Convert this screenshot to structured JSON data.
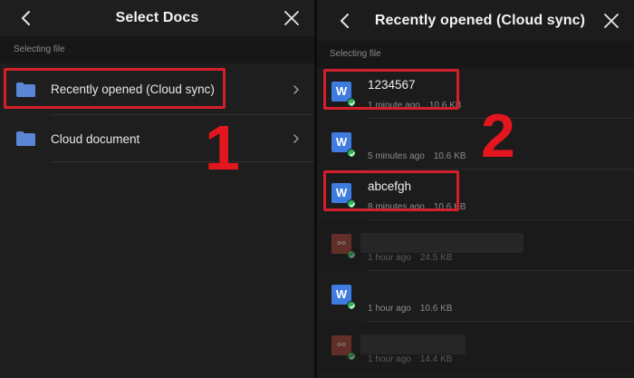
{
  "left": {
    "title": "Select Docs",
    "section_label": "Selecting file",
    "items": [
      {
        "label": "Recently opened (Cloud sync)"
      },
      {
        "label": "Cloud document"
      }
    ],
    "step": "1"
  },
  "right": {
    "title": "Recently opened (Cloud sync)",
    "section_label": "Selecting file",
    "step": "2",
    "files": [
      {
        "name": "1234567",
        "time": "1 minute ago",
        "size": "10.6 KB",
        "type": "word"
      },
      {
        "name": "",
        "time": "5 minutes ago",
        "size": "10.6 KB",
        "type": "word"
      },
      {
        "name": "abcefgh",
        "time": "8 minutes ago",
        "size": "10.6 KB",
        "type": "word"
      },
      {
        "name": "",
        "time": "1 hour ago",
        "size": "24.5 KB",
        "type": "ppt"
      },
      {
        "name": "",
        "time": "1 hour ago",
        "size": "10.6 KB",
        "type": "word"
      },
      {
        "name": "",
        "time": "1 hour ago",
        "size": "14.4 KB",
        "type": "ppt"
      }
    ]
  },
  "colors": {
    "highlight": "#d4202a",
    "step_number": "#e3161d",
    "folder": "#5b86d6",
    "word": "#3f7ce0",
    "check": "#2fb559"
  },
  "icons": {
    "back": "chevron-left-icon",
    "close": "close-icon",
    "folder": "folder-icon",
    "chevron": "chevron-right-icon",
    "word": "word-doc-icon",
    "ppt": "presentation-doc-icon",
    "synced": "check-circle-icon"
  }
}
